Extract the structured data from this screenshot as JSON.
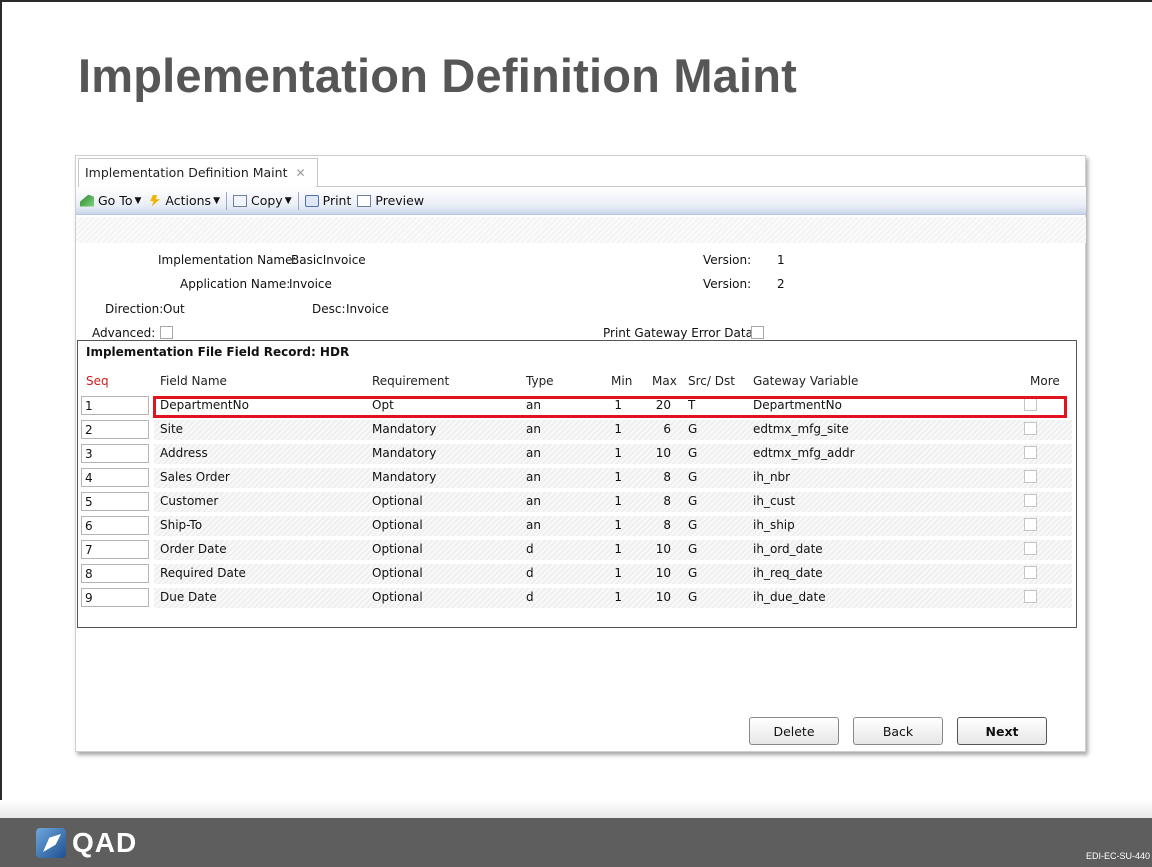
{
  "slide": {
    "title": "Implementation Definition Maint",
    "footer_code": "EDI-EC-SU-440",
    "logo_text": "QAD"
  },
  "window": {
    "tab_label": "Implementation Definition Maint",
    "toolbar": {
      "goto_label": "Go To",
      "actions_label": "Actions",
      "copy_label": "Copy",
      "print_label": "Print",
      "preview_label": "Preview"
    }
  },
  "form": {
    "impl_name_label": "Implementation Name:",
    "impl_name_value": "BasicInvoice",
    "app_name_label": "Application Name:",
    "app_name_value": "Invoice",
    "version1_label": "Version:",
    "version1_value": "1",
    "version2_label": "Version:",
    "version2_value": "2",
    "direction_label": "Direction:",
    "direction_value": "Out",
    "desc_label": "Desc:",
    "desc_value": "Invoice",
    "advanced_label": "Advanced:",
    "print_error_label": "Print Gateway Error Data:"
  },
  "grid": {
    "title": "Implementation File Field Record: HDR",
    "headers": {
      "seq": "Seq",
      "field_name": "Field Name",
      "requirement": "Requirement",
      "type": "Type",
      "min": "Min",
      "max": "Max",
      "src_dst": "Src/ Dst",
      "gateway_variable": "Gateway Variable",
      "more": "More"
    },
    "rows": [
      {
        "seq": "1",
        "field": "DepartmentNo",
        "req": "Opt",
        "type": "an",
        "min": "1",
        "max": "20",
        "src": "T",
        "gw": "DepartmentNo"
      },
      {
        "seq": "2",
        "field": "Site",
        "req": "Mandatory",
        "type": "an",
        "min": "1",
        "max": "6",
        "src": "G",
        "gw": "edtmx_mfg_site"
      },
      {
        "seq": "3",
        "field": "Address",
        "req": "Mandatory",
        "type": "an",
        "min": "1",
        "max": "10",
        "src": "G",
        "gw": "edtmx_mfg_addr"
      },
      {
        "seq": "4",
        "field": "Sales Order",
        "req": "Mandatory",
        "type": "an",
        "min": "1",
        "max": "8",
        "src": "G",
        "gw": "ih_nbr"
      },
      {
        "seq": "5",
        "field": "Customer",
        "req": "Optional",
        "type": "an",
        "min": "1",
        "max": "8",
        "src": "G",
        "gw": "ih_cust"
      },
      {
        "seq": "6",
        "field": "Ship-To",
        "req": "Optional",
        "type": "an",
        "min": "1",
        "max": "8",
        "src": "G",
        "gw": "ih_ship"
      },
      {
        "seq": "7",
        "field": "Order Date",
        "req": "Optional",
        "type": "d",
        "min": "1",
        "max": "10",
        "src": "G",
        "gw": "ih_ord_date"
      },
      {
        "seq": "8",
        "field": "Required Date",
        "req": "Optional",
        "type": "d",
        "min": "1",
        "max": "10",
        "src": "G",
        "gw": "ih_req_date"
      },
      {
        "seq": "9",
        "field": "Due Date",
        "req": "Optional",
        "type": "d",
        "min": "1",
        "max": "10",
        "src": "G",
        "gw": "ih_due_date"
      }
    ]
  },
  "buttons": {
    "delete_label": "Delete",
    "back_label": "Back",
    "next_label": "Next"
  },
  "colors": {
    "highlight": "#e0141e",
    "seq_header": "#d21c1c"
  }
}
